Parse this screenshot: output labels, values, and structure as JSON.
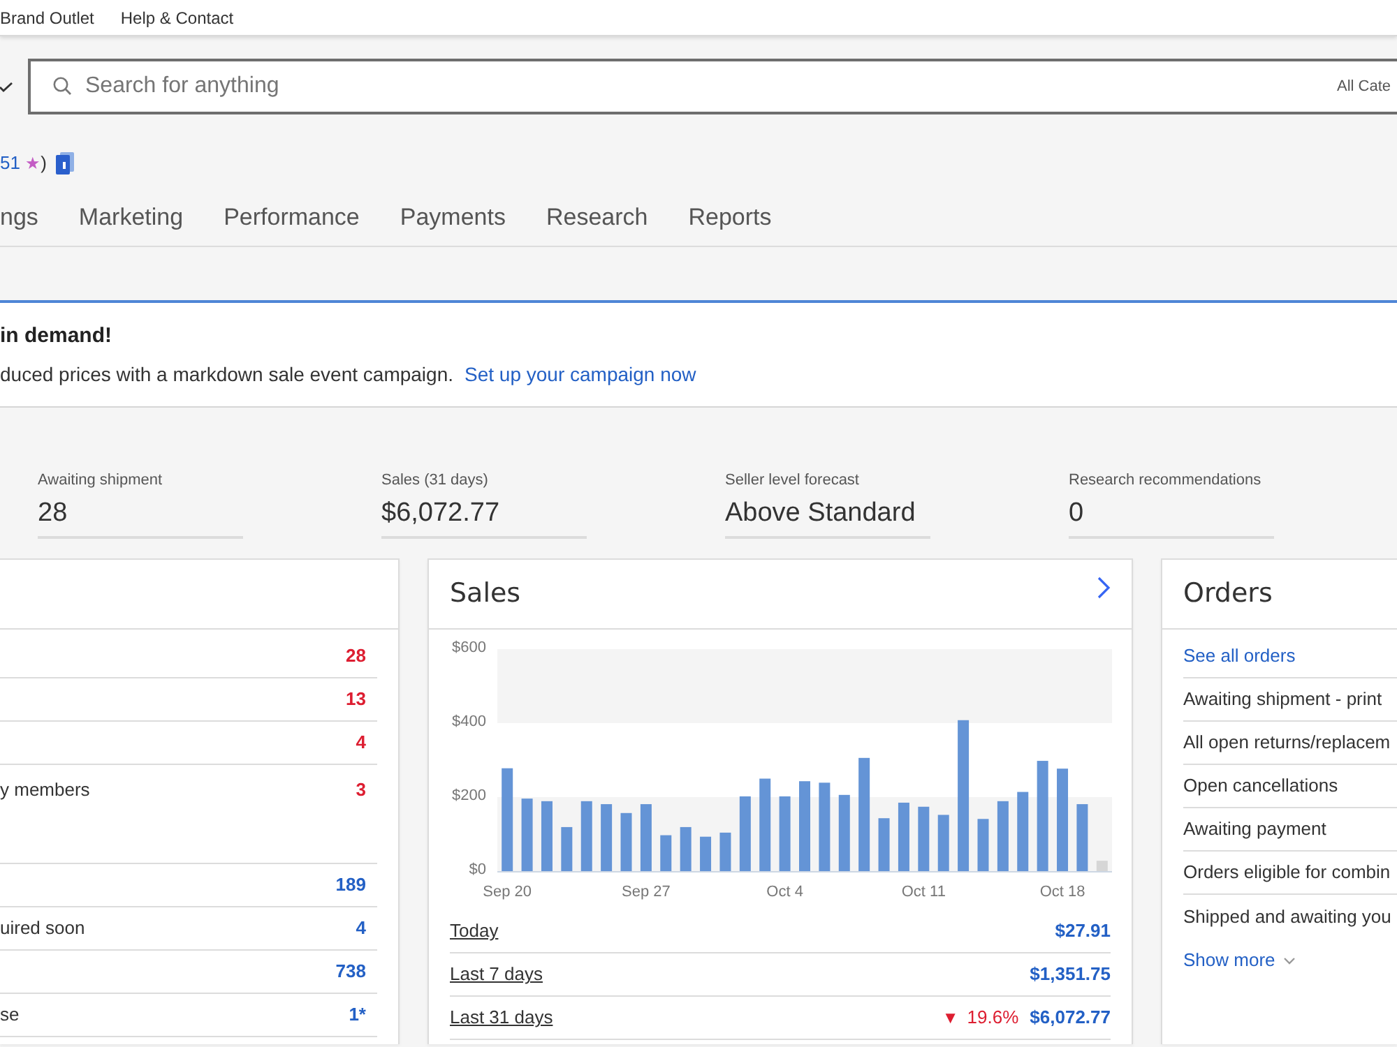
{
  "top_links": [
    "Brand Outlet",
    "Help & Contact"
  ],
  "search": {
    "placeholder": "Search for anything",
    "category": "All Cate"
  },
  "feedback": {
    "score": "51",
    "star": "★",
    "suffix": ")"
  },
  "nav_tabs": [
    "ngs",
    "Marketing",
    "Performance",
    "Payments",
    "Research",
    "Reports"
  ],
  "banner": {
    "title": "in demand!",
    "message": "duced prices with a markdown sale event campaign.",
    "link": "Set up your campaign now"
  },
  "stats": [
    {
      "label": "Awaiting shipment",
      "value": "28"
    },
    {
      "label": "Sales (31 days)",
      "value": "$6,072.77"
    },
    {
      "label": "Seller level forecast",
      "value": "Above Standard"
    },
    {
      "label": "Research recommendations",
      "value": "0"
    }
  ],
  "left_panel": {
    "rows": [
      {
        "kind": "plain",
        "count": "28",
        "color": "#dd1e31"
      },
      {
        "kind": "plain",
        "count": "13",
        "color": "#dd1e31"
      },
      {
        "kind": "plain",
        "count": "4",
        "color": "#dd1e31"
      },
      {
        "kind": "expanded",
        "label": "y members",
        "count": "3",
        "color": "#dd1e31"
      },
      {
        "kind": "plain",
        "count": "189",
        "color": "#2360c5"
      },
      {
        "kind": "plain",
        "label": "uired soon",
        "count": "4",
        "color": "#2360c5"
      },
      {
        "kind": "plain",
        "count": "738",
        "color": "#2360c5"
      },
      {
        "kind": "plain",
        "label": "se",
        "count": "1*",
        "color": "#2360c5"
      }
    ]
  },
  "sales_panel": {
    "title": "Sales",
    "chart_data": {
      "type": "bar",
      "categories": [
        "Sep 20",
        null,
        null,
        null,
        null,
        null,
        null,
        "Sep 27",
        null,
        null,
        null,
        null,
        null,
        null,
        "Oct 4",
        null,
        null,
        null,
        null,
        null,
        null,
        "Oct 11",
        null,
        null,
        null,
        null,
        null,
        null,
        "Oct 18",
        null,
        null
      ],
      "series": [
        {
          "color": "#6494d6",
          "values": [
            278,
            196,
            189,
            119,
            189,
            181,
            157,
            181,
            97,
            119,
            93,
            104,
            202,
            250,
            202,
            243,
            239,
            206,
            306,
            143,
            185,
            174,
            152,
            408,
            141,
            189,
            214,
            298,
            277,
            181,
            null
          ]
        },
        {
          "color": "#d6d6d6",
          "values": [
            null,
            null,
            null,
            null,
            null,
            null,
            null,
            null,
            null,
            null,
            null,
            null,
            null,
            null,
            null,
            null,
            null,
            null,
            null,
            null,
            null,
            null,
            null,
            null,
            null,
            null,
            null,
            null,
            null,
            null,
            28
          ]
        }
      ],
      "ylim": [
        0,
        600
      ],
      "yticks": [
        {
          "value": 0,
          "label": "$0"
        },
        {
          "value": 200,
          "label": "$200"
        },
        {
          "value": 400,
          "label": "$400"
        },
        {
          "value": 600,
          "label": "$600"
        }
      ]
    },
    "summary": [
      {
        "label": "Today",
        "value": "$27.91"
      },
      {
        "label": "Last 7 days",
        "value": "$1,351.75"
      },
      {
        "label": "Last 31 days",
        "value": "$6,072.77",
        "change": {
          "arrow": "▼",
          "text": "19.6%",
          "color": "#dd1e31"
        }
      }
    ]
  },
  "orders_panel": {
    "title": "Orders",
    "see_all": "See all orders",
    "items": [
      "Awaiting shipment - print",
      "All open returns/replacem",
      "Open cancellations",
      "Awaiting payment",
      "Orders eligible for combin",
      "Shipped and awaiting you"
    ],
    "show_more": "Show more"
  }
}
